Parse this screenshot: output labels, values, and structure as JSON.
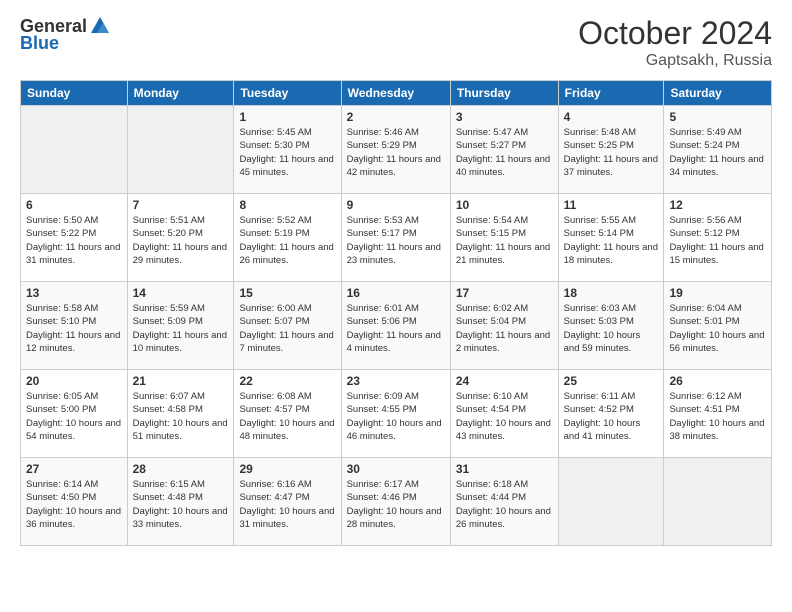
{
  "header": {
    "logo_general": "General",
    "logo_blue": "Blue",
    "month": "October 2024",
    "location": "Gaptsakh, Russia"
  },
  "weekdays": [
    "Sunday",
    "Monday",
    "Tuesday",
    "Wednesday",
    "Thursday",
    "Friday",
    "Saturday"
  ],
  "weeks": [
    [
      {
        "day": "",
        "info": ""
      },
      {
        "day": "",
        "info": ""
      },
      {
        "day": "1",
        "info": "Sunrise: 5:45 AM\nSunset: 5:30 PM\nDaylight: 11 hours and 45 minutes."
      },
      {
        "day": "2",
        "info": "Sunrise: 5:46 AM\nSunset: 5:29 PM\nDaylight: 11 hours and 42 minutes."
      },
      {
        "day": "3",
        "info": "Sunrise: 5:47 AM\nSunset: 5:27 PM\nDaylight: 11 hours and 40 minutes."
      },
      {
        "day": "4",
        "info": "Sunrise: 5:48 AM\nSunset: 5:25 PM\nDaylight: 11 hours and 37 minutes."
      },
      {
        "day": "5",
        "info": "Sunrise: 5:49 AM\nSunset: 5:24 PM\nDaylight: 11 hours and 34 minutes."
      }
    ],
    [
      {
        "day": "6",
        "info": "Sunrise: 5:50 AM\nSunset: 5:22 PM\nDaylight: 11 hours and 31 minutes."
      },
      {
        "day": "7",
        "info": "Sunrise: 5:51 AM\nSunset: 5:20 PM\nDaylight: 11 hours and 29 minutes."
      },
      {
        "day": "8",
        "info": "Sunrise: 5:52 AM\nSunset: 5:19 PM\nDaylight: 11 hours and 26 minutes."
      },
      {
        "day": "9",
        "info": "Sunrise: 5:53 AM\nSunset: 5:17 PM\nDaylight: 11 hours and 23 minutes."
      },
      {
        "day": "10",
        "info": "Sunrise: 5:54 AM\nSunset: 5:15 PM\nDaylight: 11 hours and 21 minutes."
      },
      {
        "day": "11",
        "info": "Sunrise: 5:55 AM\nSunset: 5:14 PM\nDaylight: 11 hours and 18 minutes."
      },
      {
        "day": "12",
        "info": "Sunrise: 5:56 AM\nSunset: 5:12 PM\nDaylight: 11 hours and 15 minutes."
      }
    ],
    [
      {
        "day": "13",
        "info": "Sunrise: 5:58 AM\nSunset: 5:10 PM\nDaylight: 11 hours and 12 minutes."
      },
      {
        "day": "14",
        "info": "Sunrise: 5:59 AM\nSunset: 5:09 PM\nDaylight: 11 hours and 10 minutes."
      },
      {
        "day": "15",
        "info": "Sunrise: 6:00 AM\nSunset: 5:07 PM\nDaylight: 11 hours and 7 minutes."
      },
      {
        "day": "16",
        "info": "Sunrise: 6:01 AM\nSunset: 5:06 PM\nDaylight: 11 hours and 4 minutes."
      },
      {
        "day": "17",
        "info": "Sunrise: 6:02 AM\nSunset: 5:04 PM\nDaylight: 11 hours and 2 minutes."
      },
      {
        "day": "18",
        "info": "Sunrise: 6:03 AM\nSunset: 5:03 PM\nDaylight: 10 hours and 59 minutes."
      },
      {
        "day": "19",
        "info": "Sunrise: 6:04 AM\nSunset: 5:01 PM\nDaylight: 10 hours and 56 minutes."
      }
    ],
    [
      {
        "day": "20",
        "info": "Sunrise: 6:05 AM\nSunset: 5:00 PM\nDaylight: 10 hours and 54 minutes."
      },
      {
        "day": "21",
        "info": "Sunrise: 6:07 AM\nSunset: 4:58 PM\nDaylight: 10 hours and 51 minutes."
      },
      {
        "day": "22",
        "info": "Sunrise: 6:08 AM\nSunset: 4:57 PM\nDaylight: 10 hours and 48 minutes."
      },
      {
        "day": "23",
        "info": "Sunrise: 6:09 AM\nSunset: 4:55 PM\nDaylight: 10 hours and 46 minutes."
      },
      {
        "day": "24",
        "info": "Sunrise: 6:10 AM\nSunset: 4:54 PM\nDaylight: 10 hours and 43 minutes."
      },
      {
        "day": "25",
        "info": "Sunrise: 6:11 AM\nSunset: 4:52 PM\nDaylight: 10 hours and 41 minutes."
      },
      {
        "day": "26",
        "info": "Sunrise: 6:12 AM\nSunset: 4:51 PM\nDaylight: 10 hours and 38 minutes."
      }
    ],
    [
      {
        "day": "27",
        "info": "Sunrise: 6:14 AM\nSunset: 4:50 PM\nDaylight: 10 hours and 36 minutes."
      },
      {
        "day": "28",
        "info": "Sunrise: 6:15 AM\nSunset: 4:48 PM\nDaylight: 10 hours and 33 minutes."
      },
      {
        "day": "29",
        "info": "Sunrise: 6:16 AM\nSunset: 4:47 PM\nDaylight: 10 hours and 31 minutes."
      },
      {
        "day": "30",
        "info": "Sunrise: 6:17 AM\nSunset: 4:46 PM\nDaylight: 10 hours and 28 minutes."
      },
      {
        "day": "31",
        "info": "Sunrise: 6:18 AM\nSunset: 4:44 PM\nDaylight: 10 hours and 26 minutes."
      },
      {
        "day": "",
        "info": ""
      },
      {
        "day": "",
        "info": ""
      }
    ]
  ]
}
